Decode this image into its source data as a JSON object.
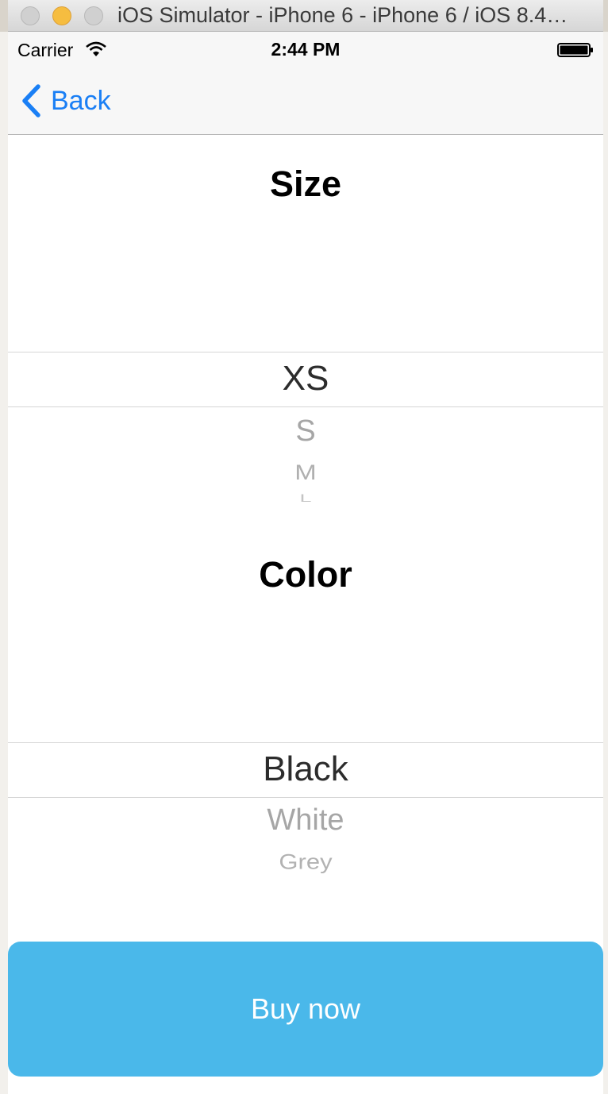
{
  "window": {
    "title": "iOS Simulator - iPhone 6 - iPhone 6 / iOS 8.4…"
  },
  "status_bar": {
    "carrier": "Carrier",
    "time": "2:44 PM"
  },
  "nav": {
    "back_label": "Back"
  },
  "size_section": {
    "title": "Size",
    "selected": "XS",
    "options": [
      "S",
      "M",
      "L"
    ]
  },
  "color_section": {
    "title": "Color",
    "selected": "Black",
    "options": [
      "White",
      "Grey"
    ]
  },
  "buy_button": {
    "label": "Buy now",
    "color": "#4ab8ea"
  },
  "colors": {
    "tint": "#1a7ff5",
    "bar": "#f7f7f7"
  },
  "icons": [
    "wifi-icon",
    "battery-icon",
    "back-chevron-icon"
  ]
}
